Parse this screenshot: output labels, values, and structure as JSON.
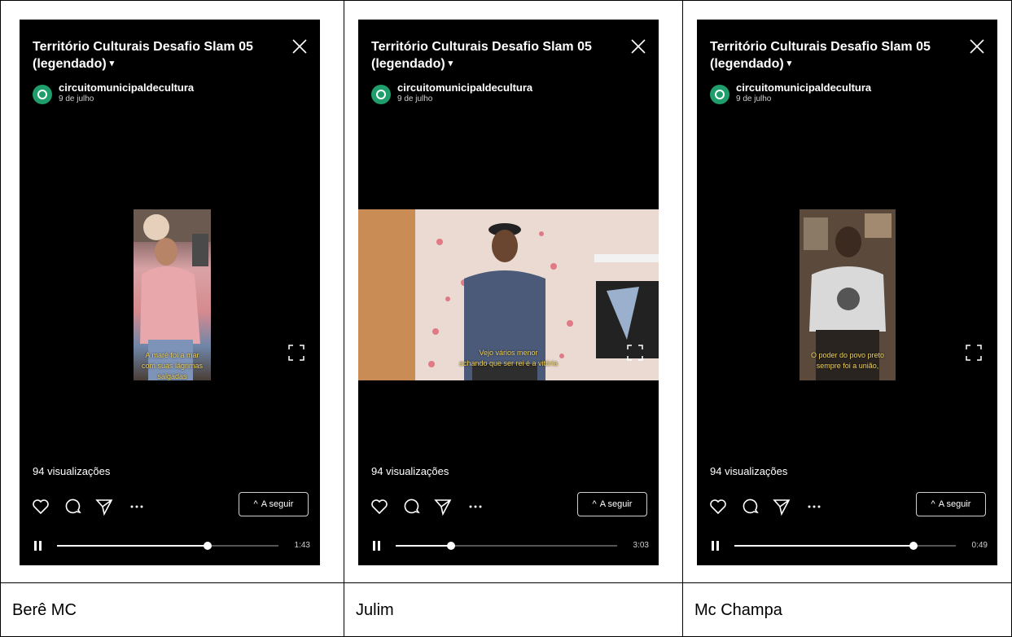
{
  "panels": [
    {
      "title": "Território Culturais  Desafio Slam 05 (legendado)",
      "account": "circuitomunicipaldecultura",
      "date": "9 de julho",
      "subtitle_line1": "A maré foi a mar",
      "subtitle_line2": "com suas lágrimas salgadas",
      "views": "94 visualizações",
      "follow_label": "A seguir",
      "time": "1:43",
      "progress": 0.68,
      "caption": "Berê MC",
      "video_colors": [
        "#d58a8e",
        "#e6d0bc",
        "#6b5a50"
      ]
    },
    {
      "title": "Território Culturais  Desafio Slam 05 (legendado)",
      "account": "circuitomunicipaldecultura",
      "date": "9 de julho",
      "subtitle_line1": "Vejo vários menor",
      "subtitle_line2": "achando que ser rei é a vitória",
      "views": "94 visualizações",
      "follow_label": "A seguir",
      "time": "3:03",
      "progress": 0.25,
      "caption": "Julim",
      "video_colors": [
        "#e9d4cc",
        "#4b5a78",
        "#8a5a3a"
      ]
    },
    {
      "title": "Território Culturais  Desafio Slam 05 (legendado)",
      "account": "circuitomunicipaldecultura",
      "date": "9 de julho",
      "subtitle_line1": "O poder do povo preto",
      "subtitle_line2": "sempre foi a união,",
      "views": "94 visualizações",
      "follow_label": "A seguir",
      "time": "0:49",
      "progress": 0.81,
      "caption": "Mc Champa",
      "video_colors": [
        "#6e5a48",
        "#cfcfcf",
        "#3b3028"
      ]
    }
  ],
  "colors": {
    "accent": "#1f9e6b",
    "subtitle": "#f0d35c",
    "background": "#000000"
  },
  "icons": [
    "close-icon",
    "fullscreen-icon",
    "heart-icon",
    "comment-icon",
    "send-icon",
    "more-icon",
    "chevron-up-icon",
    "pause-icon"
  ]
}
